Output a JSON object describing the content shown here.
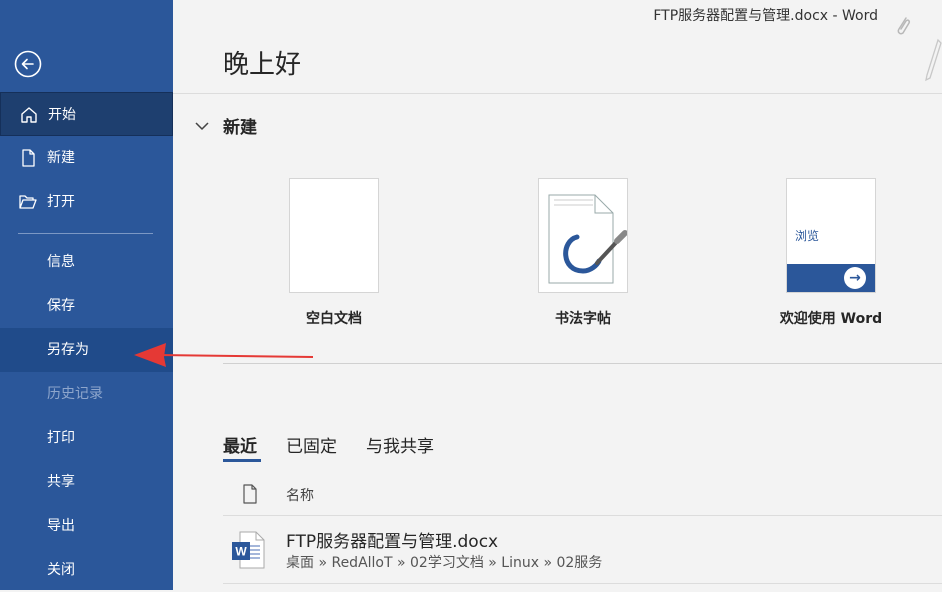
{
  "title_bar": {
    "text": "FTP服务器配置与管理.docx  -  Word"
  },
  "sidebar": {
    "items": [
      {
        "label": "开始",
        "icon": "home-icon"
      },
      {
        "label": "新建",
        "icon": "new-doc-icon"
      },
      {
        "label": "打开",
        "icon": "folder-open-icon"
      },
      {
        "label": "信息"
      },
      {
        "label": "保存"
      },
      {
        "label": "另存为"
      },
      {
        "label": "历史记录"
      },
      {
        "label": "打印"
      },
      {
        "label": "共享"
      },
      {
        "label": "导出"
      },
      {
        "label": "关闭"
      }
    ]
  },
  "main": {
    "greeting": "晚上好",
    "new_section": {
      "title": "新建",
      "templates": [
        {
          "label": "空白文档"
        },
        {
          "label": "书法字帖"
        },
        {
          "label": "欢迎使用 Word",
          "thumb_text": "浏览"
        }
      ]
    },
    "tabs": [
      {
        "label": "最近"
      },
      {
        "label": "已固定"
      },
      {
        "label": "与我共享"
      }
    ],
    "list_header": {
      "name": "名称"
    },
    "files": [
      {
        "name": "FTP服务器配置与管理.docx",
        "path": "桌面 » RedAlloT » 02学习文档 » Linux » 02服务"
      }
    ]
  },
  "colors": {
    "accent": "#2b579a",
    "annotation_arrow": "#e53935"
  }
}
